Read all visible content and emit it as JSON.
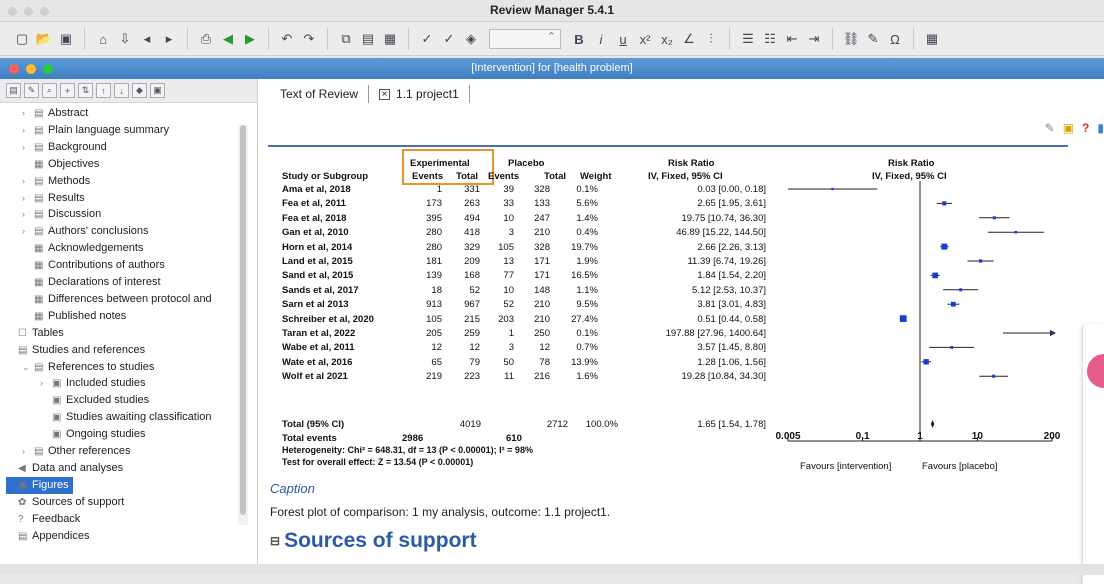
{
  "app": {
    "title": "Review Manager 5.4.1"
  },
  "toolbar": {
    "zoom_value": ""
  },
  "document": {
    "title": "[Intervention] for [health problem]"
  },
  "tabs": [
    {
      "label": "Text of Review"
    },
    {
      "label": "1.1 project1"
    }
  ],
  "sidebar": {
    "items": [
      {
        "label": "Abstract"
      },
      {
        "label": "Plain language summary"
      },
      {
        "label": "Background"
      },
      {
        "label": "Objectives"
      },
      {
        "label": "Methods"
      },
      {
        "label": "Results"
      },
      {
        "label": "Discussion"
      },
      {
        "label": "Authors' conclusions"
      },
      {
        "label": "Acknowledgements"
      },
      {
        "label": "Contributions of authors"
      },
      {
        "label": "Declarations of interest"
      },
      {
        "label": "Differences between protocol and"
      },
      {
        "label": "Published notes"
      },
      {
        "label": "Tables"
      },
      {
        "label": "Studies and references"
      },
      {
        "label": "References to studies"
      },
      {
        "label": "Included studies"
      },
      {
        "label": "Excluded studies"
      },
      {
        "label": "Studies awaiting classification"
      },
      {
        "label": "Ongoing studies"
      },
      {
        "label": "Other references"
      },
      {
        "label": "Data and analyses"
      },
      {
        "label": "Figures"
      },
      {
        "label": "Sources of support"
      },
      {
        "label": "Feedback"
      },
      {
        "label": "Appendices"
      }
    ]
  },
  "figure": {
    "group_experimental": "Experimental",
    "group_placebo": "Placebo",
    "rr_header": "Risk Ratio",
    "rr_subheader": "IV, Fixed, 95% CI",
    "forest_header": "Risk Ratio",
    "forest_subheader": "IV, Fixed, 95% CI",
    "col_study": "Study or Subgroup",
    "col_events": "Events",
    "col_total": "Total",
    "col_events2": "Events",
    "col_total2": "Total",
    "col_weight": "Weight",
    "total_label": "Total (95% CI)",
    "total_exp": "4019",
    "total_pla": "2712",
    "total_weight": "100.0%",
    "total_rr": "1.65 [1.54, 1.78]",
    "events_label": "Total events",
    "events_exp": "2986",
    "events_pla": "610",
    "heterogeneity": "Heterogeneity: Chi² = 648.31, df = 13 (P < 0.00001); I² = 98%",
    "overall": "Test for overall effect: Z = 13.54 (P < 0.00001)",
    "axis_ticks": [
      "0.005",
      "0.1",
      "1",
      "10",
      "200"
    ],
    "favours_left": "Favours [intervention]",
    "favours_right": "Favours [placebo]"
  },
  "chart_data": {
    "type": "forest",
    "log_scale": true,
    "xlim": [
      0.005,
      200
    ],
    "rows": [
      {
        "study": "Ama et al, 2018",
        "e_events": "1",
        "e_total": "331",
        "p_events": "39",
        "p_total": "328",
        "weight": "0.1%",
        "rr_text": "0.03 [0.00, 0.18]",
        "rr": 0.03,
        "lo": 0.0,
        "hi": 0.18
      },
      {
        "study": "Fea et al, 2011",
        "e_events": "173",
        "e_total": "263",
        "p_events": "33",
        "p_total": "133",
        "weight": "5.6%",
        "rr_text": "2.65 [1.95, 3.61]",
        "rr": 2.65,
        "lo": 1.95,
        "hi": 3.61
      },
      {
        "study": "Fea et al, 2018",
        "e_events": "395",
        "e_total": "494",
        "p_events": "10",
        "p_total": "247",
        "weight": "1.4%",
        "rr_text": "19.75 [10.74, 36.30]",
        "rr": 19.75,
        "lo": 10.74,
        "hi": 36.3
      },
      {
        "study": "Gan et al, 2010",
        "e_events": "280",
        "e_total": "418",
        "p_events": "3",
        "p_total": "210",
        "weight": "0.4%",
        "rr_text": "46.89 [15.22, 144.50]",
        "rr": 46.89,
        "lo": 15.22,
        "hi": 144.5
      },
      {
        "study": "Horn et al, 2014",
        "e_events": "280",
        "e_total": "329",
        "p_events": "105",
        "p_total": "328",
        "weight": "19.7%",
        "rr_text": "2.66 [2.26, 3.13]",
        "rr": 2.66,
        "lo": 2.26,
        "hi": 3.13
      },
      {
        "study": "Land et al, 2015",
        "e_events": "181",
        "e_total": "209",
        "p_events": "13",
        "p_total": "171",
        "weight": "1.9%",
        "rr_text": "11.39 [6.74, 19.26]",
        "rr": 11.39,
        "lo": 6.74,
        "hi": 19.26
      },
      {
        "study": "Sand et al, 2015",
        "e_events": "139",
        "e_total": "168",
        "p_events": "77",
        "p_total": "171",
        "weight": "16.5%",
        "rr_text": "1.84 [1.54, 2.20]",
        "rr": 1.84,
        "lo": 1.54,
        "hi": 2.2
      },
      {
        "study": "Sands et al, 2017",
        "e_events": "18",
        "e_total": "52",
        "p_events": "10",
        "p_total": "148",
        "weight": "1.1%",
        "rr_text": "5.12 [2.53, 10.37]",
        "rr": 5.12,
        "lo": 2.53,
        "hi": 10.37
      },
      {
        "study": "Sarn et al 2013",
        "e_events": "913",
        "e_total": "967",
        "p_events": "52",
        "p_total": "210",
        "weight": "9.5%",
        "rr_text": "3.81 [3.01, 4.83]",
        "rr": 3.81,
        "lo": 3.01,
        "hi": 4.83
      },
      {
        "study": "Schreiber et al, 2020",
        "e_events": "105",
        "e_total": "215",
        "p_events": "203",
        "p_total": "210",
        "weight": "27.4%",
        "rr_text": "0.51 [0.44, 0.58]",
        "rr": 0.51,
        "lo": 0.44,
        "hi": 0.58
      },
      {
        "study": "Taran et al, 2022",
        "e_events": "205",
        "e_total": "259",
        "p_events": "1",
        "p_total": "250",
        "weight": "0.1%",
        "rr_text": "197.88 [27.96, 1400.64]",
        "rr": 197.88,
        "lo": 27.96,
        "hi": 1400.64
      },
      {
        "study": "Wabe et al, 2011",
        "e_events": "12",
        "e_total": "12",
        "p_events": "3",
        "p_total": "12",
        "weight": "0.7%",
        "rr_text": "3.57 [1.45, 8.80]",
        "rr": 3.57,
        "lo": 1.45,
        "hi": 8.8
      },
      {
        "study": "Wate et al, 2016",
        "e_events": "65",
        "e_total": "79",
        "p_events": "50",
        "p_total": "78",
        "weight": "13.9%",
        "rr_text": "1.28 [1.06, 1.56]",
        "rr": 1.28,
        "lo": 1.06,
        "hi": 1.56
      },
      {
        "study": "Wolf et al 2021",
        "e_events": "219",
        "e_total": "223",
        "p_events": "11",
        "p_total": "216",
        "weight": "1.6%",
        "rr_text": "19.28 [10.84, 34.30]",
        "rr": 19.28,
        "lo": 10.84,
        "hi": 34.3
      }
    ],
    "total": {
      "rr": 1.65,
      "lo": 1.54,
      "hi": 1.78
    }
  },
  "caption": {
    "label": "Caption",
    "text": "Forest plot of comparison: 1 my analysis, outcome: 1.1 project1."
  },
  "section": {
    "title": "Sources of support"
  },
  "colors": {
    "accent": "#2a5aa8",
    "selection": "#2f6fcf",
    "highlight": "#f0922a",
    "point": "#1a3ccf"
  }
}
